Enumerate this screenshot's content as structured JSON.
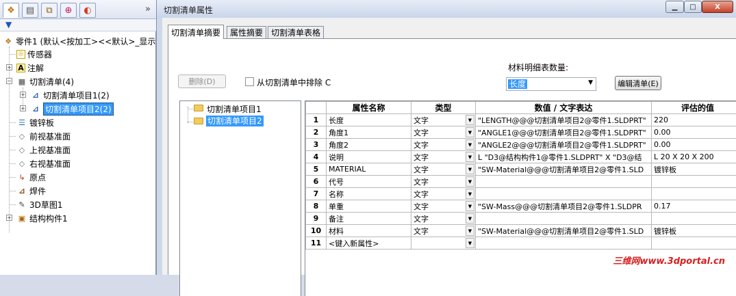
{
  "feature_manager": {
    "expand_glyph": "»",
    "tabs": [
      {
        "icon": "feature-tree-icon",
        "glyph": "❖"
      },
      {
        "icon": "property-manager-icon",
        "glyph": "▤"
      },
      {
        "icon": "configuration-manager-icon",
        "glyph": "⧉"
      },
      {
        "icon": "dimxpert-icon",
        "glyph": "⊕"
      },
      {
        "icon": "display-manager-icon",
        "glyph": "◐"
      }
    ],
    "filter_icon": "filter-icon",
    "tree": {
      "root": "零件1 (默认<按加工><<默认>_显示",
      "items": [
        {
          "label": "传感器",
          "icon": "sensor-icon"
        },
        {
          "label": "注解",
          "icon": "annotation-icon"
        },
        {
          "label": "切割清单(4)",
          "icon": "cut-list-icon"
        },
        {
          "label": "切割清单项目1(2)",
          "icon": "cut-list-item-icon"
        },
        {
          "label": "切割清单项目2(2)",
          "icon": "cut-list-item-icon"
        },
        {
          "label": "镀锌板",
          "icon": "material-icon"
        },
        {
          "label": "前视基准面",
          "icon": "plane-icon"
        },
        {
          "label": "上视基准面",
          "icon": "plane-icon"
        },
        {
          "label": "右视基准面",
          "icon": "plane-icon"
        },
        {
          "label": "原点",
          "icon": "origin-icon"
        },
        {
          "label": "焊件",
          "icon": "weldment-icon"
        },
        {
          "label": "3D草图1",
          "icon": "sketch-3d-icon"
        },
        {
          "label": "结构构件1",
          "icon": "structural-member-icon"
        }
      ]
    }
  },
  "dialog": {
    "title": "切割清单属性",
    "window_buttons": {
      "minimize": "▁",
      "maximize": "□",
      "close": "X"
    },
    "tabs": [
      "切割清单摘要",
      "属性摘要",
      "切割清单表格"
    ],
    "active_tab": 0,
    "delete_button": "删除(D)",
    "exclude_checkbox": {
      "label": "从切割清单中排除 C",
      "checked": false
    },
    "bom_qty_label": "材料明细表数量:",
    "bom_qty_value": "长度",
    "edit_list_button": "编辑清单(E)",
    "item_tree": [
      "切割清单项目1",
      "切割清单项目2"
    ],
    "selected_item": 1,
    "table": {
      "columns": [
        "属性名称",
        "类型",
        "数值 / 文字表达",
        "评估的值"
      ],
      "rows": [
        {
          "n": "1",
          "name": "长度",
          "type": "文字",
          "expr": "\"LENGTH@@@切割清单项目2@零件1.SLDPRT\"",
          "value": "220"
        },
        {
          "n": "2",
          "name": "角度1",
          "type": "文字",
          "expr": "\"ANGLE1@@@切割清单项目2@零件1.SLDPRT\"",
          "value": "0.00"
        },
        {
          "n": "3",
          "name": "角度2",
          "type": "文字",
          "expr": "\"ANGLE2@@@切割清单项目2@零件1.SLDPRT\"",
          "value": "0.00"
        },
        {
          "n": "4",
          "name": "说明",
          "type": "文字",
          "expr": "L \"D3@结构构件1@零件1.SLDPRT\" X \"D3@结",
          "value": "L 20 X 20 X 200"
        },
        {
          "n": "5",
          "name": "MATERIAL",
          "type": "文字",
          "expr": "\"SW-Material@@@切割清单项目2@零件1.SLD",
          "value": "镀锌板"
        },
        {
          "n": "6",
          "name": "代号",
          "type": "文字",
          "expr": "",
          "value": ""
        },
        {
          "n": "7",
          "name": "名称",
          "type": "文字",
          "expr": "",
          "value": ""
        },
        {
          "n": "8",
          "name": "单重",
          "type": "文字",
          "expr": "\"SW-Mass@@@切割清单项目2@零件1.SLDPR",
          "value": "0.17"
        },
        {
          "n": "9",
          "name": "备注",
          "type": "文字",
          "expr": "",
          "value": ""
        },
        {
          "n": "10",
          "name": "材料",
          "type": "文字",
          "expr": "\"SW-Material@@@切割清单项目2@零件1.SLD",
          "value": "镀锌板"
        },
        {
          "n": "11",
          "name": "<键入新属性>",
          "type": "",
          "expr": "",
          "value": ""
        }
      ]
    }
  },
  "watermark": "三维网www.3dportal.cn",
  "colors": {
    "selection": "#3399ff",
    "watermark": "#d42020"
  }
}
